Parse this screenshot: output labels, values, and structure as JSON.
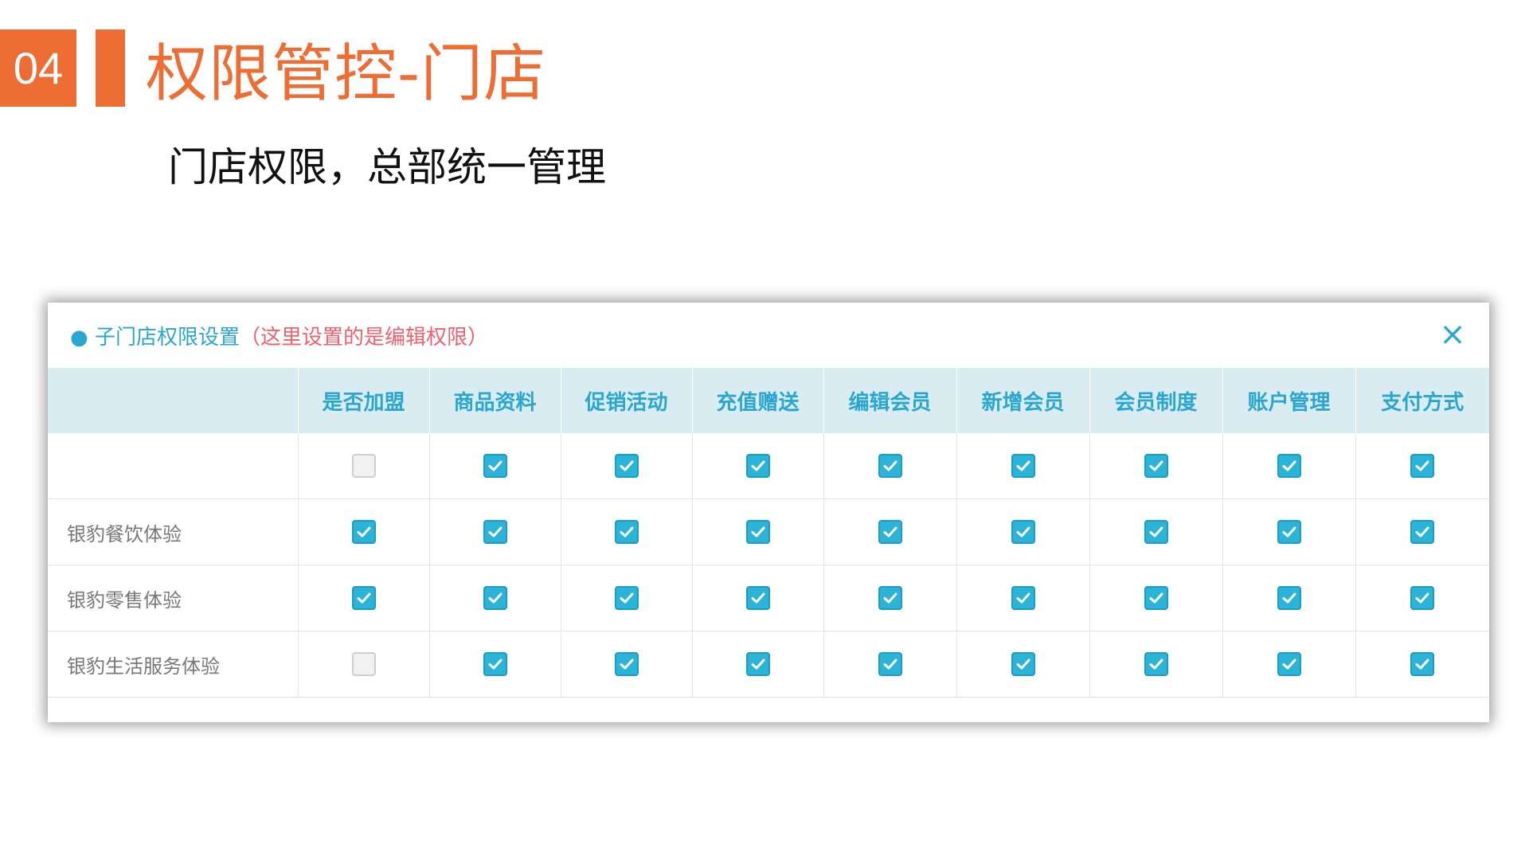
{
  "slide": {
    "number": "04",
    "title": "权限管控-门店",
    "subtitle": "门店权限，总部统一管理"
  },
  "dialog": {
    "title": "● 子门店权限设置",
    "note": "（这里设置的是编辑权限）",
    "close_icon": "×"
  },
  "table": {
    "columns": [
      "",
      "是否加盟",
      "商品资料",
      "促销活动",
      "充值赠送",
      "编辑会员",
      "新增会员",
      "会员制度",
      "账户管理",
      "支付方式"
    ],
    "rows": [
      {
        "name": "",
        "checks": [
          false,
          true,
          true,
          true,
          true,
          true,
          true,
          true,
          true
        ]
      },
      {
        "name": "银豹餐饮体验",
        "checks": [
          true,
          true,
          true,
          true,
          true,
          true,
          true,
          true,
          true
        ]
      },
      {
        "name": "银豹零售体验",
        "checks": [
          true,
          true,
          true,
          true,
          true,
          true,
          true,
          true,
          true
        ]
      },
      {
        "name": "银豹生活服务体验",
        "checks": [
          false,
          true,
          true,
          true,
          true,
          true,
          true,
          true,
          true
        ]
      }
    ]
  },
  "colors": {
    "accent": "#ED6D35",
    "header_bg": "#D8ECF2",
    "header_text": "#2BA6CF",
    "checkbox_on": "#2BB4D8",
    "note_red": "#F0606D"
  }
}
